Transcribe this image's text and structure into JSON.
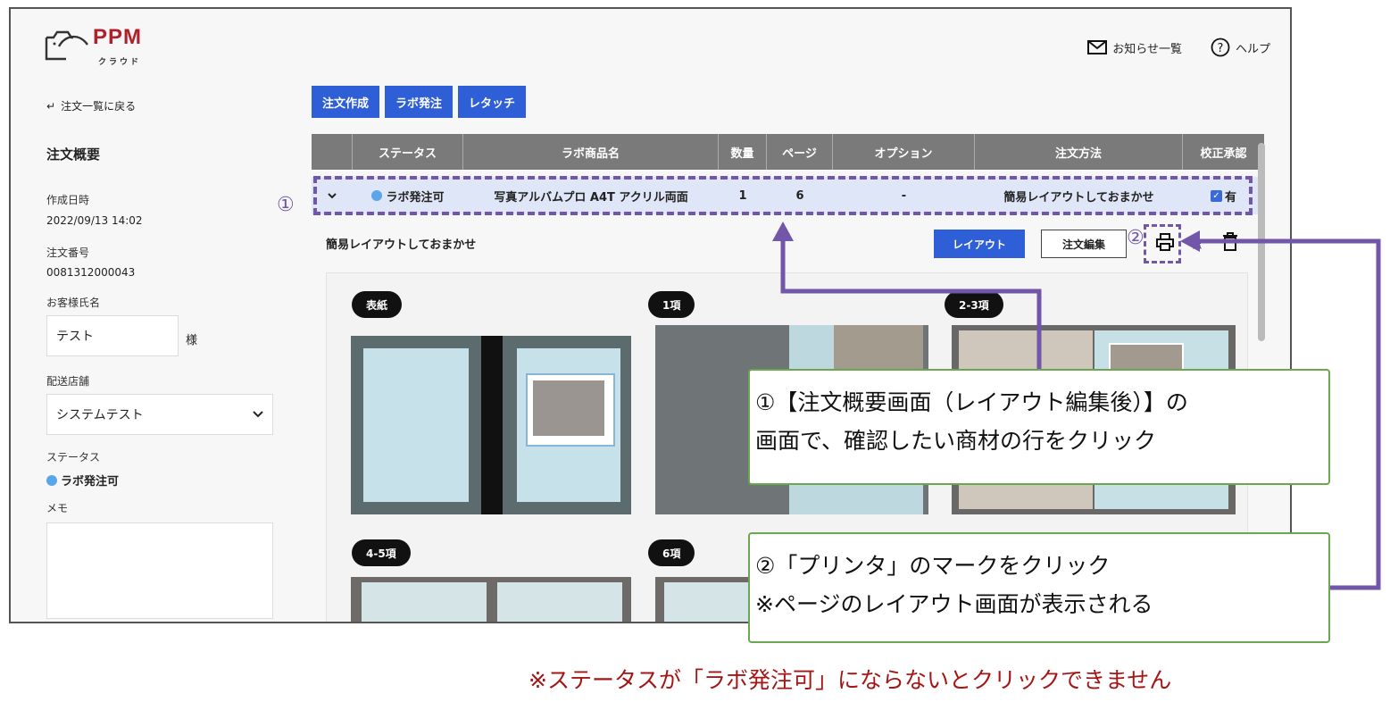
{
  "app": {
    "brand": "PPM",
    "brand_sub": "クラウド"
  },
  "topnav": {
    "notices": "お知らせ一覧",
    "help": "ヘルプ"
  },
  "sidebar": {
    "back_label": "注文一覧に戻る",
    "title": "注文概要",
    "created_label": "作成日時",
    "created_value": "2022/09/13 14:02",
    "order_no_label": "注文番号",
    "order_no_value": "0081312000043",
    "customer_label": "お客様氏名",
    "customer_value": "テスト",
    "customer_suffix": "様",
    "store_label": "配送店舗",
    "store_value": "システムテスト",
    "status_label": "ステータス",
    "status_value": "ラボ発注可",
    "memo_label": "メモ",
    "memo_value": ""
  },
  "tabs": [
    "注文作成",
    "ラボ発注",
    "レタッチ"
  ],
  "table": {
    "headers": [
      "ステータス",
      "ラボ商品名",
      "数量",
      "ページ",
      "オプション",
      "注文方法",
      "校正承認"
    ],
    "row": {
      "status": "ラボ発注可",
      "product": "写真アルバムプロ A4T アクリル両面",
      "qty": "1",
      "pages": "6",
      "option": "-",
      "method": "簡易レイアウトしておまかせ",
      "approval": "有",
      "approval_checked": true
    }
  },
  "section": {
    "title": "簡易レイアウトしておまかせ",
    "layout_button": "レイアウト",
    "edit_button": "注文編集"
  },
  "pages": [
    "表紙",
    "1項",
    "2-3項",
    "4-5項",
    "6項"
  ],
  "annotations": {
    "marker1": "①",
    "marker2": "②",
    "callout1_line1": "①【注文概要画面（レイアウト編集後）】の",
    "callout1_line2": "画面で、確認したい商材の行をクリック",
    "callout2_line1": "②「プリンタ」のマークをクリック",
    "callout2_line2": "※ページのレイアウト画面が表示される",
    "note": "※ステータスが「ラボ発注可」にならないとクリックできません"
  },
  "colors": {
    "brand": "#b0202a",
    "accent": "#2f5fd6",
    "status_dot": "#5aa6e8",
    "annotation": "#7256a9",
    "callout_border": "#6aa84f",
    "note": "#a41515"
  }
}
